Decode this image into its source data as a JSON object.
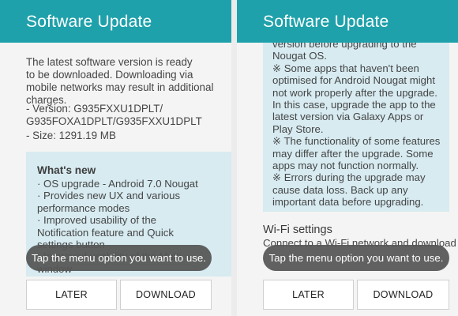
{
  "left": {
    "title": "Software Update",
    "intro": "The latest software version is ready\nto be downloaded. Downloading via\nmobile networks may result in additional\ncharges.",
    "version": " - Version: G935FXXU1DPLT/\n   G935FOXA1DPLT/G935FXXU1DPLT",
    "size": " - Size: 1291.19 MB",
    "whats_new_heading": "What's new",
    "whats_new_lines": "· OS upgrade - Android 7.0 Nougat\n· Provides new UX and various\n  performance modes\n· Improved usability of the\n  Notification feature and Quick\n  settings button\n· Improved usability of the Multi\n  window",
    "toast": "Tap the menu option you want to use.",
    "later": "LATER",
    "download": "DOWNLOAD"
  },
  "right": {
    "title": "Software Update",
    "notes": "version before upgrading to the\nNougat OS.\n※ Some apps that haven't been\noptimised for Android Nougat might\nnot work properly after the upgrade.\nIn this case, upgrade the app to the\nlatest version via Galaxy Apps or\nPlay Store.\n※ The functionality of some features\nmay differ after the upgrade. Some\napps may not function normally.\n※ Errors during the upgrade may\ncause data loss. Back up any\nimportant data before upgrading.",
    "wifi_title": "Wi-Fi settings",
    "wifi_sub": "Connect to a Wi-Fi network and download",
    "toast": "Tap the menu option you want to use.",
    "later": "LATER",
    "download": "DOWNLOAD"
  },
  "colors": {
    "header": "#1fa1ab",
    "info_box": "#d7ebf1",
    "toast": "#555555"
  }
}
